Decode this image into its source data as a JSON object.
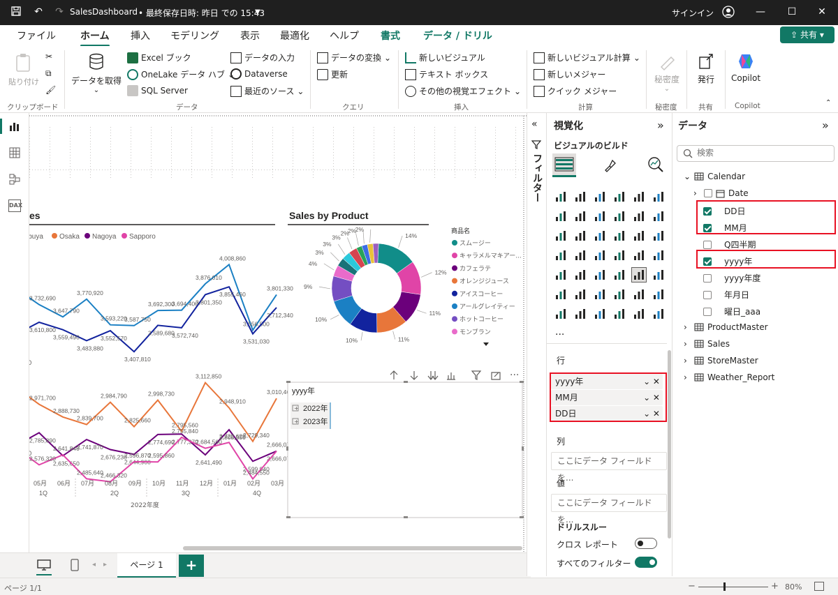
{
  "titlebar": {
    "doc": "SalesDashboard",
    "saved": "• 最終保存日時: 昨日 での 15:43",
    "signin": "サインイン"
  },
  "tabs": [
    "ファイル",
    "ホーム",
    "挿入",
    "モデリング",
    "表示",
    "最適化",
    "ヘルプ",
    "書式",
    "データ / ドリル"
  ],
  "share_label": "共有",
  "ribbon": {
    "paste": "貼り付け",
    "getdata": "データを取得",
    "excel": "Excel ブック",
    "onelake": "OneLake データ ハブ",
    "sql": "SQL Server",
    "enterdata": "データの入力",
    "dataverse": "Dataverse",
    "recent": "最近のソース",
    "transform": "データの変換",
    "refresh": "更新",
    "newvisual": "新しいビジュアル",
    "textbox": "テキスト ボックス",
    "morevisuals": "その他の視覚エフェクト",
    "newcalc": "新しいビジュアル計算",
    "newmeasure": "新しいメジャー",
    "quickmeasure": "クイック メジャー",
    "sensitivity": "秘密度",
    "publish": "発行",
    "copilot": "Copilot",
    "groups": {
      "clipboard": "クリップボード",
      "data": "データ",
      "query": "クエリ",
      "insert": "挿入",
      "calc": "計算",
      "sens": "秘密度",
      "share": "共有",
      "copilot": "Copilot"
    }
  },
  "canvas": {
    "line_title_fragment": "es",
    "line_legend": [
      "ibuya",
      "Osaka",
      "Nagoya",
      "Sapporo"
    ],
    "legend_colors": [
      "#1b80c4",
      "#e8763a",
      "#6b007b",
      "#e044a7"
    ],
    "donut_title": "Sales by Product",
    "donut_legend_title": "商品名",
    "matrix_header": "yyyy年",
    "matrix_rows": [
      "2022年",
      "2023年"
    ],
    "page_tab": "ページ 1"
  },
  "chart_data": [
    {
      "type": "line",
      "title": "",
      "x": [
        "05月",
        "06月",
        "07月",
        "08月",
        "09月",
        "10月",
        "11月",
        "12月",
        "01月",
        "02月",
        "03月"
      ],
      "x_groups": [
        "1Q",
        "2Q",
        "3Q",
        "4Q"
      ],
      "xlabel": "2022年度",
      "series": [
        {
          "name": "ibuya",
          "color": "#1b80c4",
          "values": [
            3732690,
            3647790,
            3770920,
            3593220,
            3587750,
            3692300,
            3694400,
            3876010,
            4008860,
            3556500,
            3801330
          ]
        },
        {
          "name": "",
          "color": "#12239e",
          "values": [
            3610800,
            3559490,
            3483880,
            3552570,
            3407810,
            3589680,
            3572740,
            3801350,
            3855460,
            3531030,
            3712340
          ]
        },
        {
          "name": "Osaka",
          "color": "#e8763a",
          "values": [
            2971700,
            2888730,
            2839700,
            2984790,
            2825660,
            2998730,
            2795560,
            3112850,
            2948910,
            2729340,
            3010460
          ]
        },
        {
          "name": "Nagoya",
          "color": "#6b007b",
          "values": [
            2785890,
            2635650,
            2741870,
            2676230,
            2644900,
            2774690,
            2777370,
            2641490,
            2805350,
            2599940,
            2666070
          ]
        },
        {
          "name": "Sapporo",
          "color": "#e044a7",
          "values": [
            2576320,
            2641840,
            2485640,
            2466320,
            2596870,
            2595860,
            2755840,
            2684560,
            2722620,
            2484550,
            2666070
          ]
        }
      ]
    },
    {
      "type": "pie",
      "title": "Sales by Product",
      "legend_title": "商品名",
      "categories": [
        "スムージー",
        "キャラメルマキアー...",
        "カフェラテ",
        "オレンジジュース",
        "アイスコーヒー",
        "アールグレイティー",
        "ホットコーヒー",
        "モンブラン"
      ],
      "colors": [
        "#118d89",
        "#e044a7",
        "#6b007b",
        "#e8763a",
        "#12239e",
        "#1b80c4",
        "#744ec2",
        "#e96bca",
        "#197278",
        "#2bc9db",
        "#d64550",
        "#29a35a",
        "#3c6ce6",
        "#e8c23a",
        "#9c5ebf"
      ],
      "values": [
        14,
        12,
        11,
        11,
        10,
        10,
        9,
        4,
        3,
        3,
        3,
        2,
        2,
        2,
        2
      ],
      "labels": [
        "14%",
        "12%",
        "11%",
        "11%",
        "10%",
        "10%",
        "9%",
        "4%",
        "3%",
        "3%",
        "3%",
        "2%",
        "2%",
        "2%",
        ""
      ]
    }
  ],
  "viz": {
    "title": "視覚化",
    "subtitle": "ビジュアルのビルド",
    "more": "...",
    "rows_label": "行",
    "rows": [
      "yyyy年",
      "MM月",
      "DD日"
    ],
    "cols_label": "列",
    "cols_placeholder": "ここにデータ フィールドを...",
    "values_label": "値",
    "values_placeholder": "ここにデータ フィールドを...",
    "drill_label": "ドリルスルー",
    "cross_report": "クロス レポート",
    "keep_filters": "すべてのフィルター"
  },
  "filter_label": "フィルター",
  "data": {
    "title": "データ",
    "search_placeholder": "検索",
    "tables": [
      "Calendar",
      "ProductMaster",
      "Sales",
      "StoreMaster",
      "Weather_Report"
    ],
    "calendar_fields": [
      {
        "label": "Date",
        "checked": false
      },
      {
        "label": "DD日",
        "checked": true
      },
      {
        "label": "MM月",
        "checked": true
      },
      {
        "label": "Q四半期",
        "checked": false
      },
      {
        "label": "yyyy年",
        "checked": true
      },
      {
        "label": "yyyy年度",
        "checked": false
      },
      {
        "label": "年月日",
        "checked": false
      },
      {
        "label": "曜日_aaa",
        "checked": false
      }
    ]
  },
  "status": {
    "page": "ページ 1/1",
    "zoom": "80%"
  },
  "colors": {
    "accent": "#117865",
    "highlight": "#e81123"
  }
}
